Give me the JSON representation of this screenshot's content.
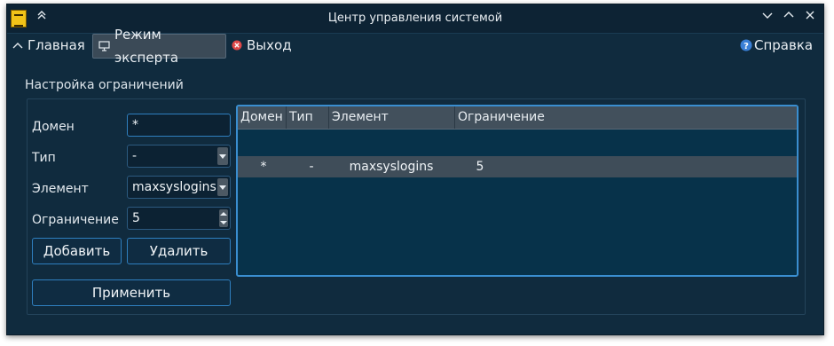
{
  "window": {
    "title": "Центр управления системой",
    "app_icon": "basealt-logo-icon"
  },
  "menu": {
    "home": "Главная",
    "expert_mode": "Режим эксперта",
    "exit": "Выход",
    "help": "Справка"
  },
  "group": {
    "title": "Настройка ограничений"
  },
  "form": {
    "domain_label": "Домен",
    "domain_value": "*",
    "type_label": "Тип",
    "type_value": "-",
    "element_label": "Элемент",
    "element_value": "maxsyslogins",
    "limit_label": "Ограничение",
    "limit_value": "5",
    "add_button": "Добавить",
    "delete_button": "Удалить",
    "apply_button": "Применить"
  },
  "table": {
    "columns": [
      "Домен",
      "Тип",
      "Элемент",
      "Ограничение"
    ],
    "rows": [
      [
        "*",
        "-",
        "maxsyslogins",
        "5"
      ]
    ]
  },
  "colors": {
    "window_bg": "#102b3e",
    "accent": "#2f7fbf",
    "exit_icon": "#e04848",
    "help_icon": "#3a7fd6"
  }
}
